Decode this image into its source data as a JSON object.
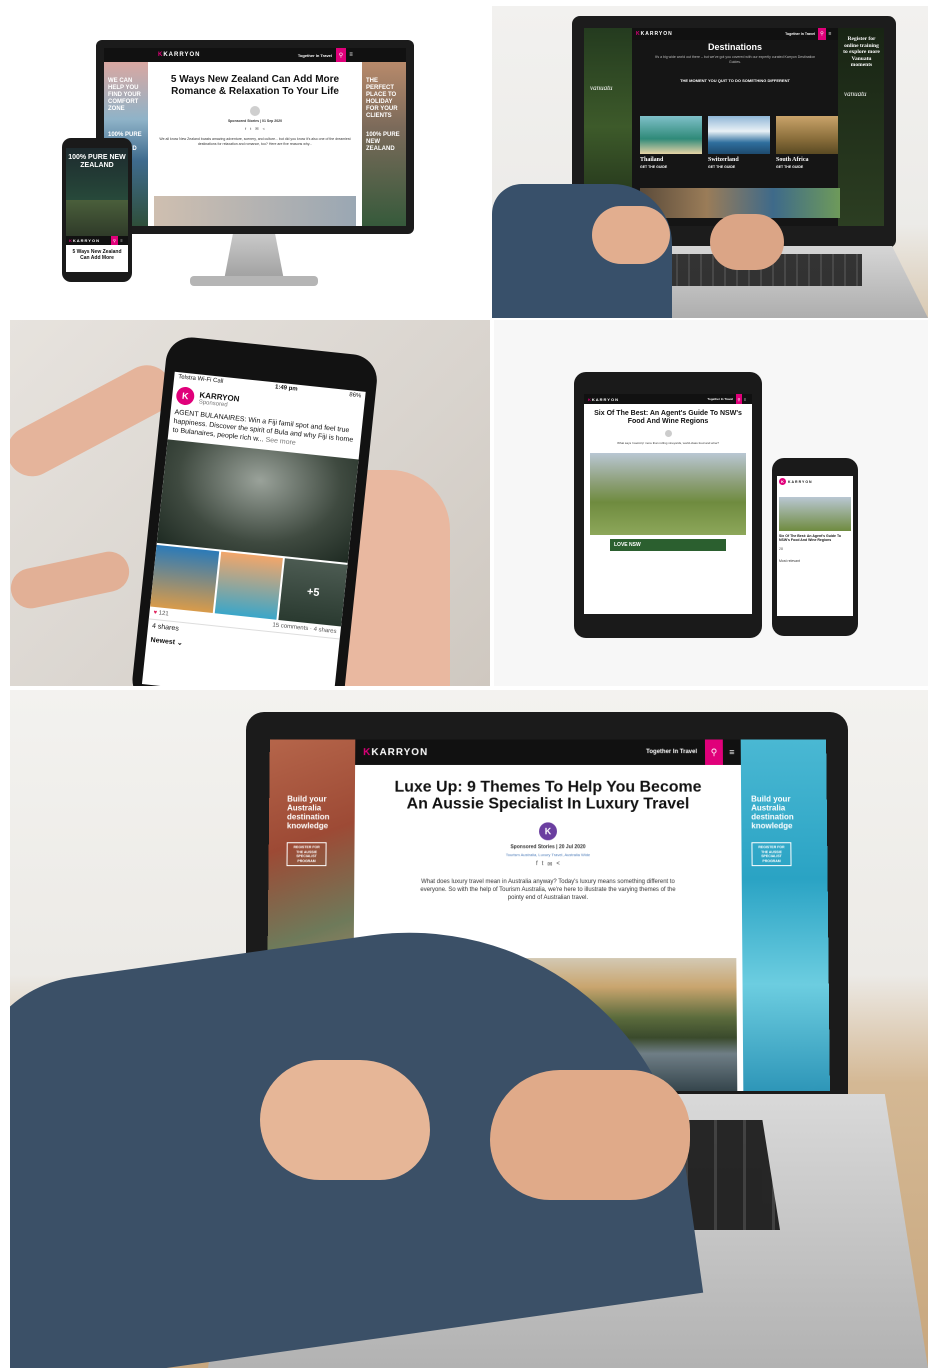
{
  "tile1": {
    "logo": "KARRYON",
    "nav_label": "Together In Travel",
    "article_title": "5 Ways New Zealand Can Add More Romance & Relaxation To Your Life",
    "meta": "Sponsored Stories | 01 Sep 2020",
    "intro": "We all know New Zealand boasts amazing adventure, scenery, and culture... but did you know it's also one of the dreamiest destinations for relaxation and romance, too? Here are five reasons why...",
    "skin_left_text": "WE CAN HELP YOU FIND YOUR COMFORT ZONE",
    "skin_left_badge": "100% PURE NEW ZEALAND",
    "skin_right_text": "THE PERFECT PLACE TO HOLIDAY FOR YOUR CLIENTS",
    "skin_right_badge": "100% PURE NEW ZEALAND",
    "phone_hero": "100% PURE NEW ZEALAND",
    "phone_logo": "KARRYON",
    "phone_title": "5 Ways New Zealand Can Add More"
  },
  "tile2": {
    "logo": "KARRYON",
    "nav_label": "Together In Travel",
    "page_title": "Destinations",
    "subtitle": "It's a big wide world out there – but we've got you covered with our expertly curated Karryon Destination Guides.",
    "banner": "THE MOMENT YOU QUIT TO DO SOMETHING DIFFERENT",
    "skin_right_text": "Register for online training to explore more Vanuatu moments",
    "skin_right_brand": "vanuatu",
    "skin_left_brand": "vanuatu",
    "cards": [
      {
        "name": "Thailand",
        "cta": "GET THE GUIDE"
      },
      {
        "name": "Switzerland",
        "cta": "GET THE GUIDE"
      },
      {
        "name": "South Africa",
        "cta": "GET THE GUIDE"
      }
    ]
  },
  "tile3": {
    "status_carrier": "Telstra Wi-Fi Call",
    "status_time": "1:49 pm",
    "status_battery": "86%",
    "page_name": "KARRYON",
    "sponsored": "Sponsored",
    "post_text": "AGENT BULANAIRES: Win a Fiji famil spot and feel true happiness. Discover the spirit of Bula and why Fiji is home to Bulanaires, people rich w...",
    "see_more": "See more",
    "reactions": "121",
    "comments": "15 comments",
    "shares": "4 shares",
    "more_photos": "+5",
    "shares_bottom": "4 shares",
    "sort": "Newest"
  },
  "tile4": {
    "logo": "KARRYON",
    "nav_label": "Together In Travel",
    "article_title": "Six Of The Best: An Agent's Guide To NSW's Food And Wine Regions",
    "intro": "What says 'road-trip' more than rolling vineyards, world-class food and wine?",
    "banner": "LOVE NSW",
    "phone_title": "Six Of The Best: An Agent's Guide To NSW's Food And Wine Regions",
    "phone_likes": "28",
    "phone_comments_label": "Most relevant"
  },
  "tile5": {
    "logo": "KARRYON",
    "nav_label": "Together In Travel",
    "article_title": "Luxe Up: 9 Themes To Help You Become An Aussie Specialist In Luxury Travel",
    "avatar_letter": "K",
    "meta": "Sponsored Stories | 20 Jul 2020",
    "tags": "Tourism Australia, Luxury Travel, Australia Wide",
    "intro": "What does luxury travel mean in Australia anyway? Today's luxury means something different to everyone. So with the help of Tourism Australia, we're here to illustrate the varying themes of the pointy end of Australian travel.",
    "skin_left_text": "Build your Australia destination knowledge",
    "skin_left_cta": "REGISTER FOR THE AUSSIE SPECIALIST PROGRAM",
    "skin_right_text": "Build your Australia destination knowledge",
    "skin_right_cta": "REGISTER FOR THE AUSSIE SPECIALIST PROGRAM"
  },
  "colors": {
    "brand_pink": "#e0007a",
    "bar_black": "#111111"
  }
}
